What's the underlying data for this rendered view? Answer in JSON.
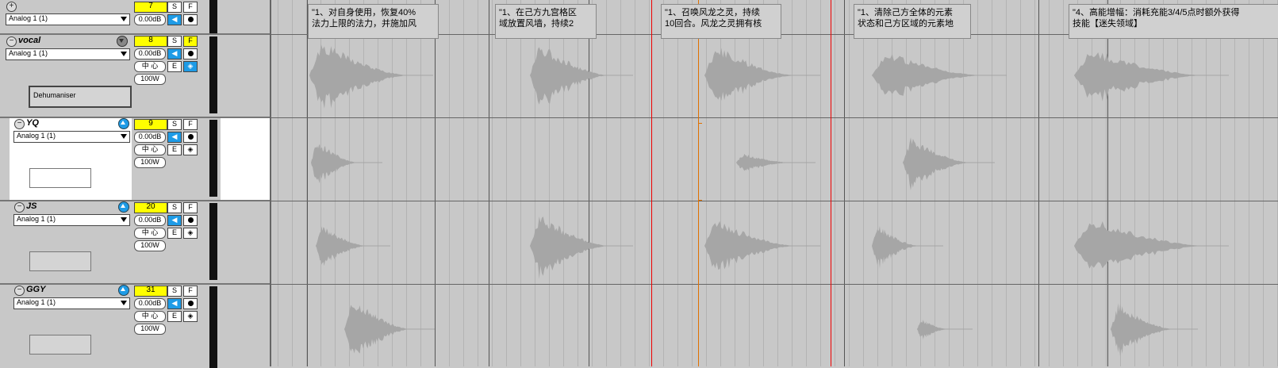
{
  "tracks": [
    {
      "name": "",
      "expand_symbol": "+",
      "input": "Analog 1 (1)",
      "volume_number": "7",
      "gain": "0.00dB",
      "solo": "S",
      "fx": "F",
      "selected": false
    },
    {
      "name": "vocal",
      "collapse_symbol": "−",
      "input": "Analog 1 (1)",
      "plugin": "Dehumaniser",
      "volume_number": "8",
      "gain": "0.00dB",
      "pan": "中 心",
      "width": "100W",
      "solo": "S",
      "fx": "F",
      "edit": "E",
      "selected": false
    },
    {
      "name": "YQ",
      "collapse_symbol": "−",
      "input": "Analog 1 (1)",
      "plugin": "",
      "volume_number": "9",
      "gain": "0.00dB",
      "pan": "中 心",
      "width": "100W",
      "solo": "S",
      "fx": "F",
      "edit": "E",
      "selected": true
    },
    {
      "name": "JS",
      "collapse_symbol": "−",
      "input": "Analog 1 (1)",
      "plugin": "",
      "volume_number": "20",
      "gain": "0.00dB",
      "pan": "中 心",
      "width": "100W",
      "solo": "S",
      "fx": "F",
      "edit": "E",
      "selected": false
    },
    {
      "name": "GGY",
      "collapse_symbol": "−",
      "input": "Analog 1 (1)",
      "plugin": "",
      "volume_number": "31",
      "gain": "0.00dB",
      "pan": "中 心",
      "width": "100W",
      "solo": "S",
      "fx": "F",
      "edit": "E",
      "selected": false
    }
  ],
  "notes": [
    {
      "line1": "\"1、对自身使用，恢复40%",
      "line2": "法力上限的法力，并施加风"
    },
    {
      "line1": "\"1、在己方九宫格区",
      "line2": "域放置风墙，持续2"
    },
    {
      "line1": "\"1、召唤风龙之灵，持续",
      "line2": "10回合。风龙之灵拥有核"
    },
    {
      "line1": "\"1、清除己方全体的元素",
      "line2": "状态和己方区域的元素地"
    },
    {
      "line1": "\"4、高能增幅：消耗充能3/4/5点时额外获得",
      "line2": "技能【迷失领域】"
    }
  ],
  "colors": {
    "accent_blue": "#1e9be6",
    "volume_yellow": "#ffff00",
    "playhead_red": "#e00000",
    "cursor_orange": "#e07000",
    "waveform": "#a6a6a6"
  },
  "icons": {
    "mute": "speaker-icon",
    "record": "record-dot-icon",
    "monitor": "monitor-icon",
    "collapse": "collapse-icon",
    "expand": "expand-icon",
    "track_arrow": "arrow-up-icon"
  }
}
